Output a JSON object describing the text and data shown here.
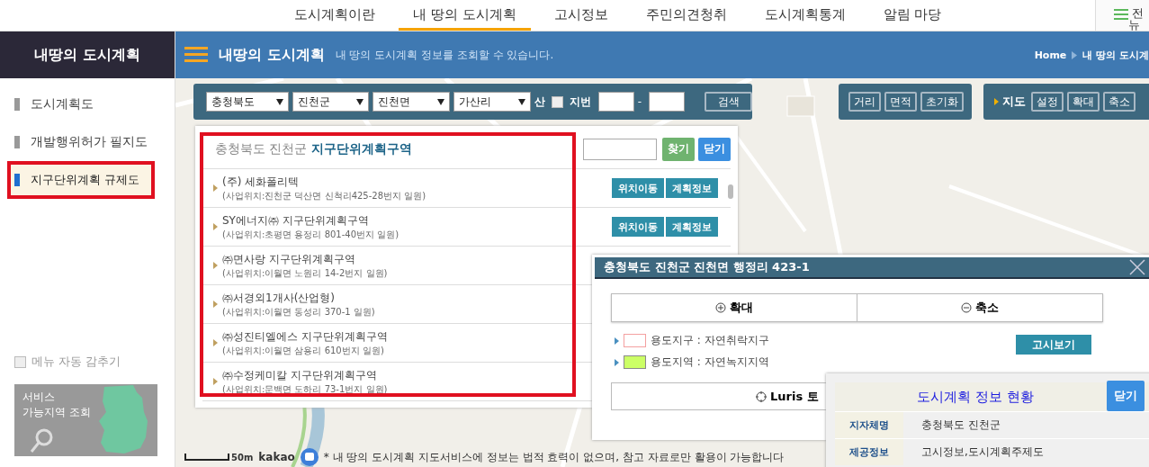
{
  "top_nav": {
    "tabs": [
      {
        "label": "도시계획이란",
        "selected": false
      },
      {
        "label": "내 땅의 도시계획",
        "selected": true
      },
      {
        "label": "고시정보",
        "selected": false
      },
      {
        "label": "주민의견청취",
        "selected": false
      },
      {
        "label": "도시계획통계",
        "selected": false
      },
      {
        "label": "알림 마당",
        "selected": false
      }
    ],
    "all_menu": [
      "전",
      "뉴"
    ]
  },
  "sidebar": {
    "title": "내땅의 도시계획",
    "items": [
      {
        "label": "도시계획도",
        "selected": false,
        "highlighted": false
      },
      {
        "label": "개발행위허가 필지도",
        "selected": false,
        "highlighted": false
      },
      {
        "label": "지구단위계획 규제도",
        "selected": true,
        "highlighted": true
      }
    ],
    "auto_hide": {
      "label": "메뉴 자동 감추기",
      "checked": false
    },
    "service_banner": {
      "lines": [
        "서비스",
        "가능지역 조회"
      ]
    }
  },
  "header": {
    "title": "내땅의 도시계획",
    "subtitle": "내 땅의 도시계획 정보를 조회할 수 있습니다.",
    "breadcrumb": [
      "Home",
      "내 땅의 도시계"
    ]
  },
  "search_bar": {
    "selects": [
      "충청북도",
      "진천군",
      "진천면",
      "가산리"
    ],
    "mountain_label": "산",
    "lot_checkbox": {
      "label": "지번",
      "checked": false
    },
    "separator": "-",
    "search_button": "검색"
  },
  "measure_tools": [
    "거리",
    "면적",
    "초기화"
  ],
  "map_tools": {
    "label": "지도",
    "buttons": [
      "설정",
      "확대",
      "축소"
    ]
  },
  "district_list": {
    "region": "충청북도 진천군",
    "title": "지구단위계획구역",
    "highlighted": true,
    "find_button": "찾기",
    "close_button": "닫기",
    "items": [
      {
        "name": "(주) 세화폴리텍",
        "location": "(사업위치:진천군 덕산면 신척리425-28번지 일원)",
        "buttons": [
          "위치이동",
          "계획정보"
        ]
      },
      {
        "name": "SY에너지㈜ 지구단위계획구역",
        "location": "(사업위치:초평면 용정리 801-40번지 일원)",
        "buttons": [
          "위치이동",
          "계획정보"
        ]
      },
      {
        "name": "㈜면사랑 지구단위계획구역",
        "location": "(사업위치:이월면 노원리 14-2번지 일원)"
      },
      {
        "name": "㈜서경외1개사(산업형)",
        "location": "(사업위치:이월면 동성리 370-1 일원)"
      },
      {
        "name": "㈜성진티엘에스 지구단위계획구역",
        "location": "(사업위치:이월면 삼용리 610번지 일원)"
      },
      {
        "name": "㈜수정케미칼 지구단위계획구역",
        "location": "(사업위치:문백면 도하리 73-1번지 일원)"
      }
    ]
  },
  "parcel_popup": {
    "title": "충청북도 진천군 진천면 행정리 423-1",
    "zoom_in": "확대",
    "zoom_out": "축소",
    "legend": [
      {
        "label": "용도지구 : 자연취락지구",
        "color": "#ffffff"
      },
      {
        "label": "용도지역 : 자연녹지지역",
        "color": "#ccff66"
      }
    ],
    "notice_button": "고시보기",
    "luris_button": "Luris 토"
  },
  "info_panel": {
    "title": "도시계획 정보 현황",
    "close_button": "닫기",
    "rows": [
      {
        "label": "지자체명",
        "value": "충청북도 진천군"
      },
      {
        "label": "제공정보",
        "value": "고시정보,도시계획주제도"
      }
    ]
  },
  "map": {
    "scale": "50m",
    "brand": "kakao",
    "notice": "* 내 땅의 도시계획 지도서비스에 정보는 법적 효력이 없으며, 참고 자료로만 활용이 가능합니다"
  }
}
